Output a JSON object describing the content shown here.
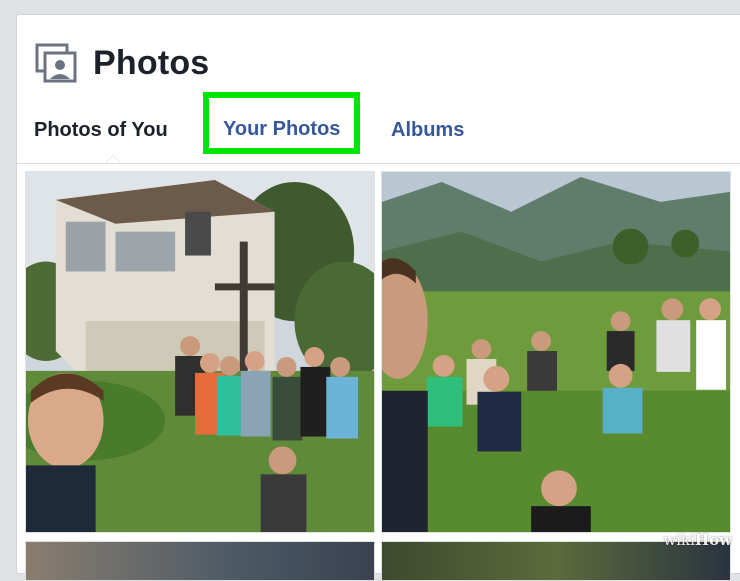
{
  "header": {
    "title": "Photos",
    "icon": "photos-icon"
  },
  "tabs": [
    {
      "id": "photos_of_you",
      "label": "Photos of You",
      "active": true
    },
    {
      "id": "your_photos",
      "label": "Your Photos",
      "highlighted": true
    },
    {
      "id": "albums",
      "label": "Albums"
    }
  ],
  "highlight_color": "#00e600",
  "link_color": "#365899",
  "watermark": {
    "wiki": "wiki",
    "how": "How"
  }
}
